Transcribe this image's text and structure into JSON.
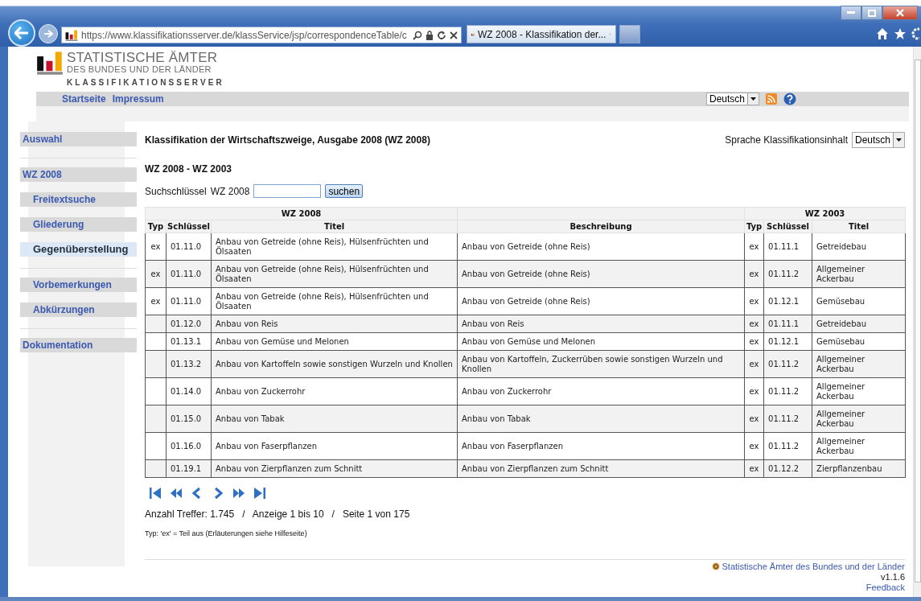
{
  "browser": {
    "url": "https://www.klassifikationsserver.de/klassService/jsp/correspondenceTable/c",
    "tabs": [
      {
        "title": "WZ 2008 - Klassifikation der...",
        "selected": true
      }
    ]
  },
  "header": {
    "logo_line1": "STATISTISCHE ÄMTER",
    "logo_line2": "DES BUNDES UND DER LÄNDER",
    "logo_line3": "KLASSIFIKATIONSSERVER"
  },
  "nav": {
    "links": [
      "Startseite",
      "Impressum"
    ],
    "language": "Deutsch"
  },
  "sidebar": {
    "groups": [
      {
        "items": [
          {
            "label": "Auswahl",
            "kind": "section",
            "selected": false
          }
        ]
      },
      {
        "items": [
          {
            "label": "WZ 2008",
            "kind": "section",
            "selected": false
          },
          {
            "label": "Freitextsuche",
            "kind": "sub",
            "selected": false
          },
          {
            "label": "Gliederung",
            "kind": "sub",
            "selected": false
          },
          {
            "label": "Gegenüberstellung",
            "kind": "sub",
            "selected": true
          }
        ]
      },
      {
        "items": [
          {
            "label": "Vorbemerkungen",
            "kind": "sub",
            "selected": false
          },
          {
            "label": "Abkürzungen",
            "kind": "sub",
            "selected": false
          }
        ]
      },
      {
        "items": [
          {
            "label": "Dokumentation",
            "kind": "section",
            "selected": false
          }
        ]
      }
    ]
  },
  "content": {
    "title": "Klassifikation der Wirtschaftszweige, Ausgabe 2008 (WZ 2008)",
    "subtitle": "WZ 2008 - WZ 2003",
    "content_language_label": "Sprache Klassifikationsinhalt",
    "content_language": "Deutsch",
    "search": {
      "label": "Suchschlüssel",
      "scheme": "WZ 2008",
      "button": "suchen"
    }
  },
  "table": {
    "group_left": "WZ 2008",
    "group_right": "WZ 2003",
    "columns": [
      "Typ",
      "Schlüssel",
      "Titel",
      "Beschreibung",
      "Typ",
      "Schlüssel",
      "Titel"
    ],
    "rows": [
      {
        "typ": "ex",
        "key": "01.11.0",
        "title": "Anbau von Getreide (ohne Reis), Hülsenfrüchten und Ölsaaten",
        "description": "Anbau von Getreide (ohne Reis)",
        "typ_2003": "ex",
        "key_2003": "01.11.1",
        "title_2003": "Getreidebau"
      },
      {
        "typ": "ex",
        "key": "01.11.0",
        "title": "Anbau von Getreide (ohne Reis), Hülsenfrüchten und Ölsaaten",
        "description": "Anbau von Getreide (ohne Reis)",
        "typ_2003": "ex",
        "key_2003": "01.11.2",
        "title_2003": "Allgemeiner Ackerbau"
      },
      {
        "typ": "ex",
        "key": "01.11.0",
        "title": "Anbau von Getreide (ohne Reis), Hülsenfrüchten und Ölsaaten",
        "description": "Anbau von Getreide (ohne Reis)",
        "typ_2003": "ex",
        "key_2003": "01.12.1",
        "title_2003": "Gemüsebau"
      },
      {
        "key": "01.12.0",
        "title": "Anbau von Reis",
        "description": "Anbau von Reis",
        "typ_2003": "ex",
        "key_2003": "01.11.1",
        "title_2003": "Getreidebau"
      },
      {
        "key": "01.13.1",
        "title": "Anbau von Gemüse und Melonen",
        "description": "Anbau von Gemüse und Melonen",
        "typ_2003": "ex",
        "key_2003": "01.12.1",
        "title_2003": "Gemüsebau"
      },
      {
        "key": "01.13.2",
        "title": "Anbau von Kartoffeln sowie sonstigen Wurzeln und Knollen",
        "description": "Anbau von Kartoffeln, Zuckerrüben sowie sonstigen Wurzeln und Knollen",
        "typ_2003": "ex",
        "key_2003": "01.11.2",
        "title_2003": "Allgemeiner Ackerbau"
      },
      {
        "key": "01.14.0",
        "title": "Anbau von Zuckerrohr",
        "description": "Anbau von Zuckerrohr",
        "typ_2003": "ex",
        "key_2003": "01.11.2",
        "title_2003": "Allgemeiner Ackerbau"
      },
      {
        "key": "01.15.0",
        "title": "Anbau von Tabak",
        "description": "Anbau von Tabak",
        "typ_2003": "ex",
        "key_2003": "01.11.2",
        "title_2003": "Allgemeiner Ackerbau"
      },
      {
        "key": "01.16.0",
        "title": "Anbau von Faserpflanzen",
        "description": "Anbau von Faserpflanzen",
        "typ_2003": "ex",
        "key_2003": "01.11.2",
        "title_2003": "Allgemeiner Ackerbau"
      },
      {
        "key": "01.19.1",
        "title": "Anbau von Zierpflanzen zum Schnitt",
        "description": "Anbau von Zierpflanzen zum Schnitt",
        "typ_2003": "ex",
        "key_2003": "01.12.2",
        "title_2003": "Zierpflanzenbau"
      }
    ]
  },
  "summary": "Anzahl Treffer: 1.745   /   Anzeige 1 bis 10   /   Seite 1 von 175",
  "note": "Typ: 'ex' = Teil aus (Erläuterungen siehe Hilfeseite)",
  "footer": {
    "copyright": "Statistische Ämter des Bundes und der Länder",
    "version": "v1.1.6",
    "feedback": "Feedback"
  }
}
